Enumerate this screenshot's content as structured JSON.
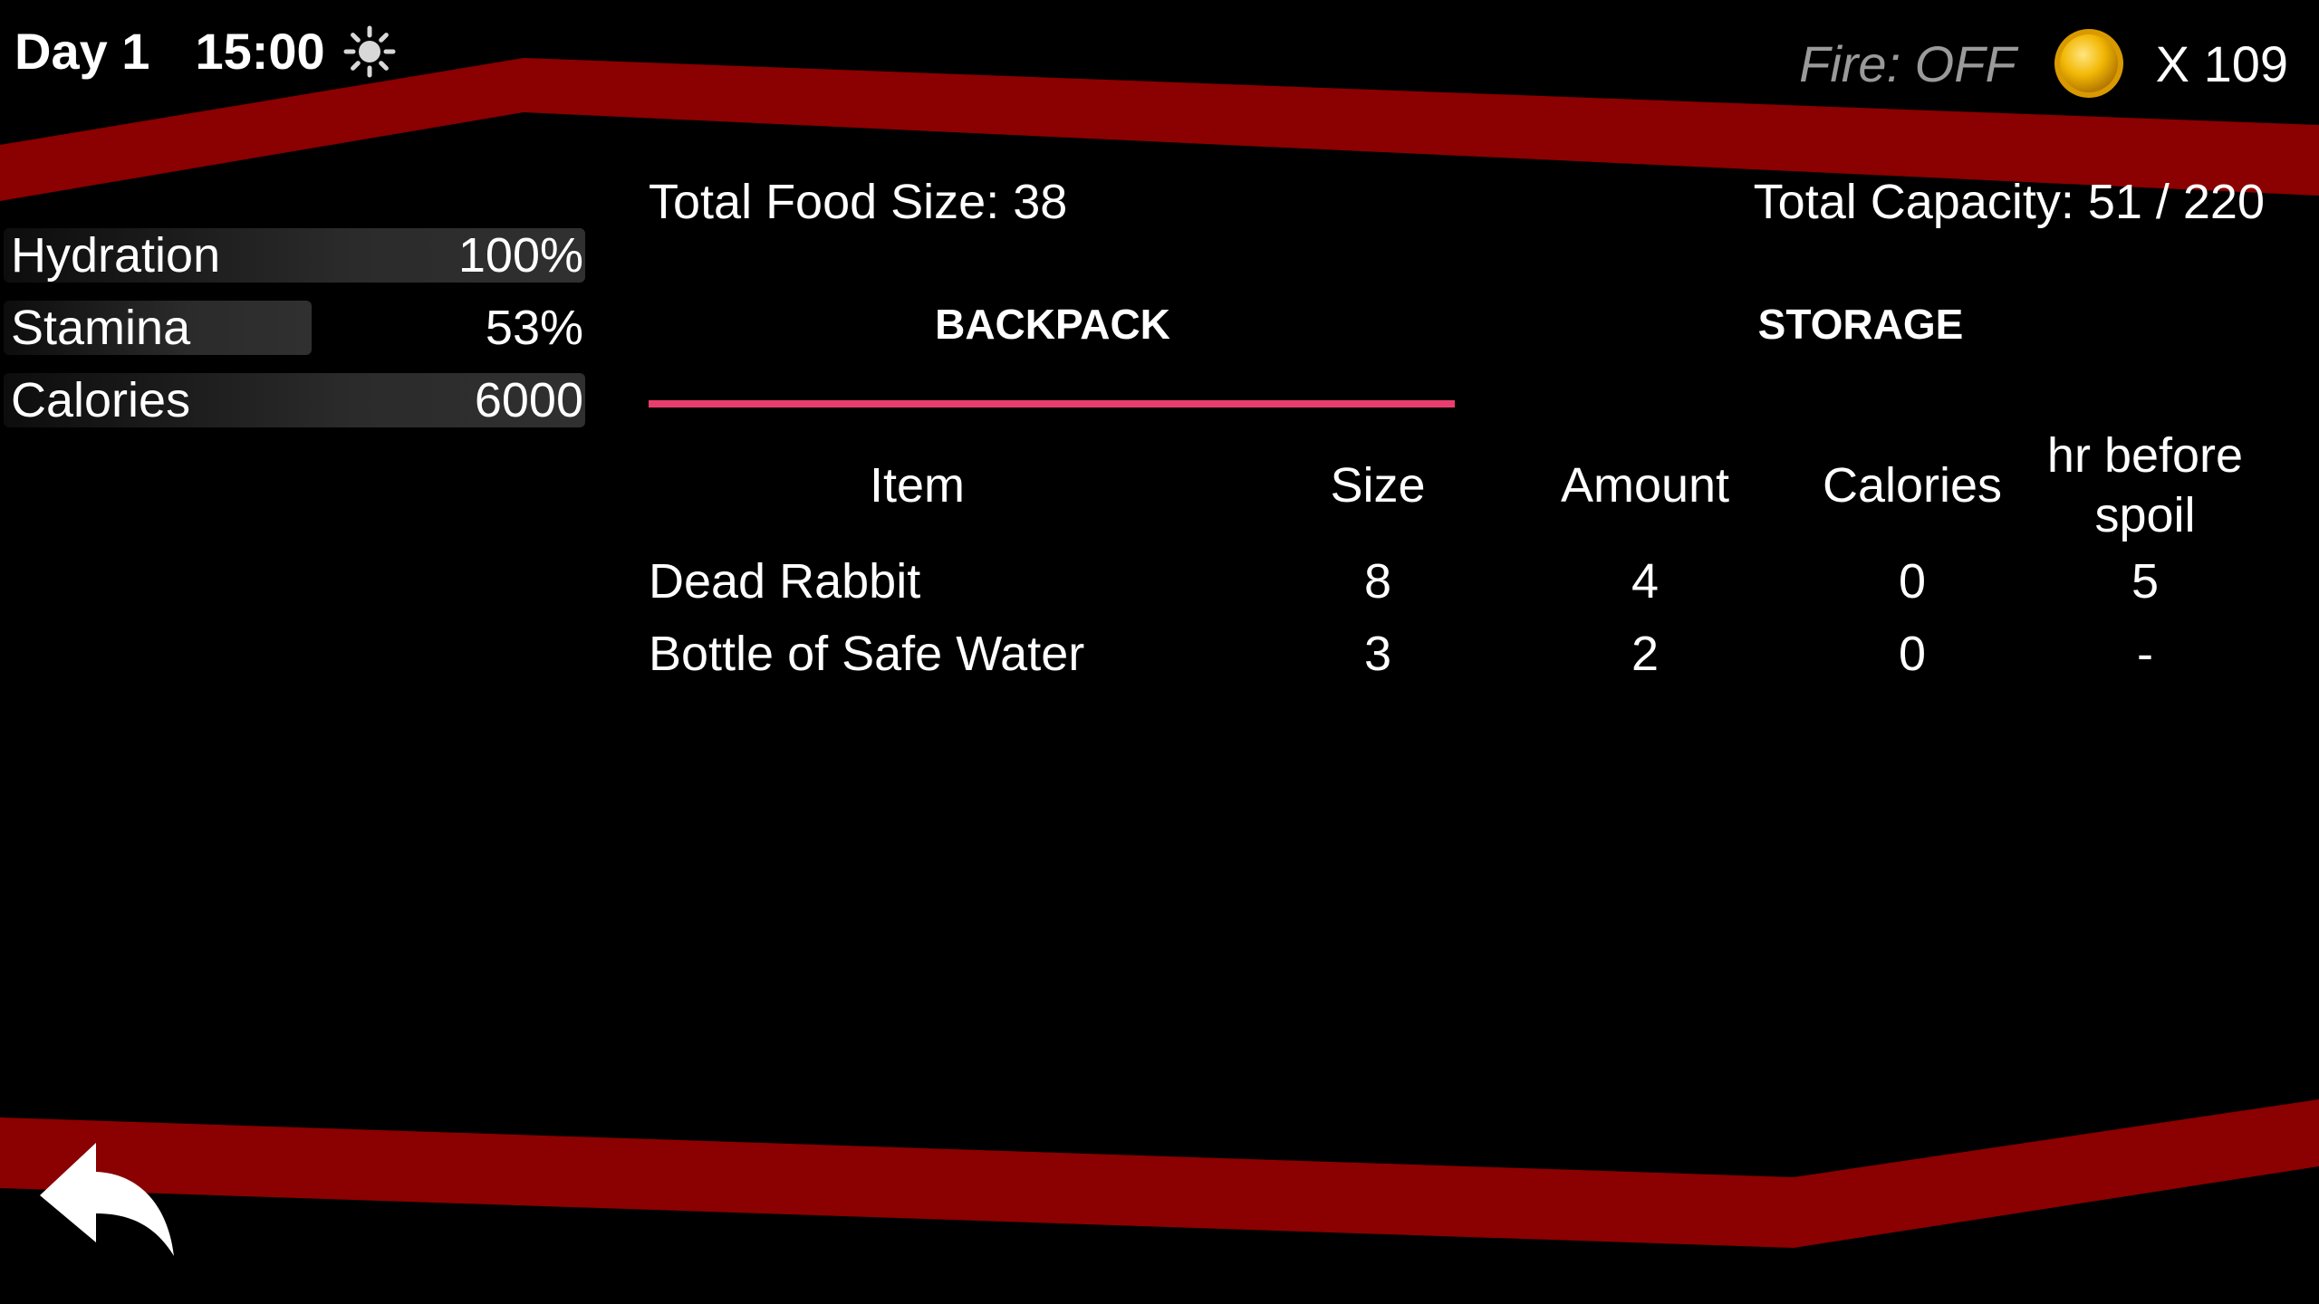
{
  "hud": {
    "day": "Day 1",
    "time": "15:00",
    "weather_icon": "sun-icon",
    "fire_status": "Fire: OFF",
    "coin_icon": "gold-coin-icon",
    "coins": "X 109"
  },
  "stats": [
    {
      "label": "Hydration",
      "value": "100%",
      "level": 1.0
    },
    {
      "label": "Stamina",
      "value": "53%",
      "level": 0.53
    },
    {
      "label": "Calories",
      "value": "6000",
      "level": 1.0
    }
  ],
  "totals": {
    "food_size": "Total Food Size: 38",
    "capacity": "Total Capacity: 51 / 220"
  },
  "tabs": [
    {
      "label": "BACKPACK",
      "selected": true
    },
    {
      "label": "STORAGE",
      "selected": false
    }
  ],
  "table": {
    "headers": [
      "Item",
      "Size",
      "Amount",
      "Calories",
      "hr before spoil"
    ],
    "rows": [
      {
        "item": "Dead Rabbit",
        "size": "8",
        "amount": "4",
        "calories": "0",
        "spoil": "5"
      },
      {
        "item": "Bottle of Safe Water",
        "size": "3",
        "amount": "2",
        "calories": "0",
        "spoil": "-"
      }
    ]
  },
  "back_button": {
    "icon": "back-arrow-icon"
  },
  "colors": {
    "background": "#000000",
    "band_red": "#8b0000",
    "tab_underline": "#e83e6e",
    "fire_text": "#9a9a9a",
    "coin_gold": "#f2b705"
  }
}
